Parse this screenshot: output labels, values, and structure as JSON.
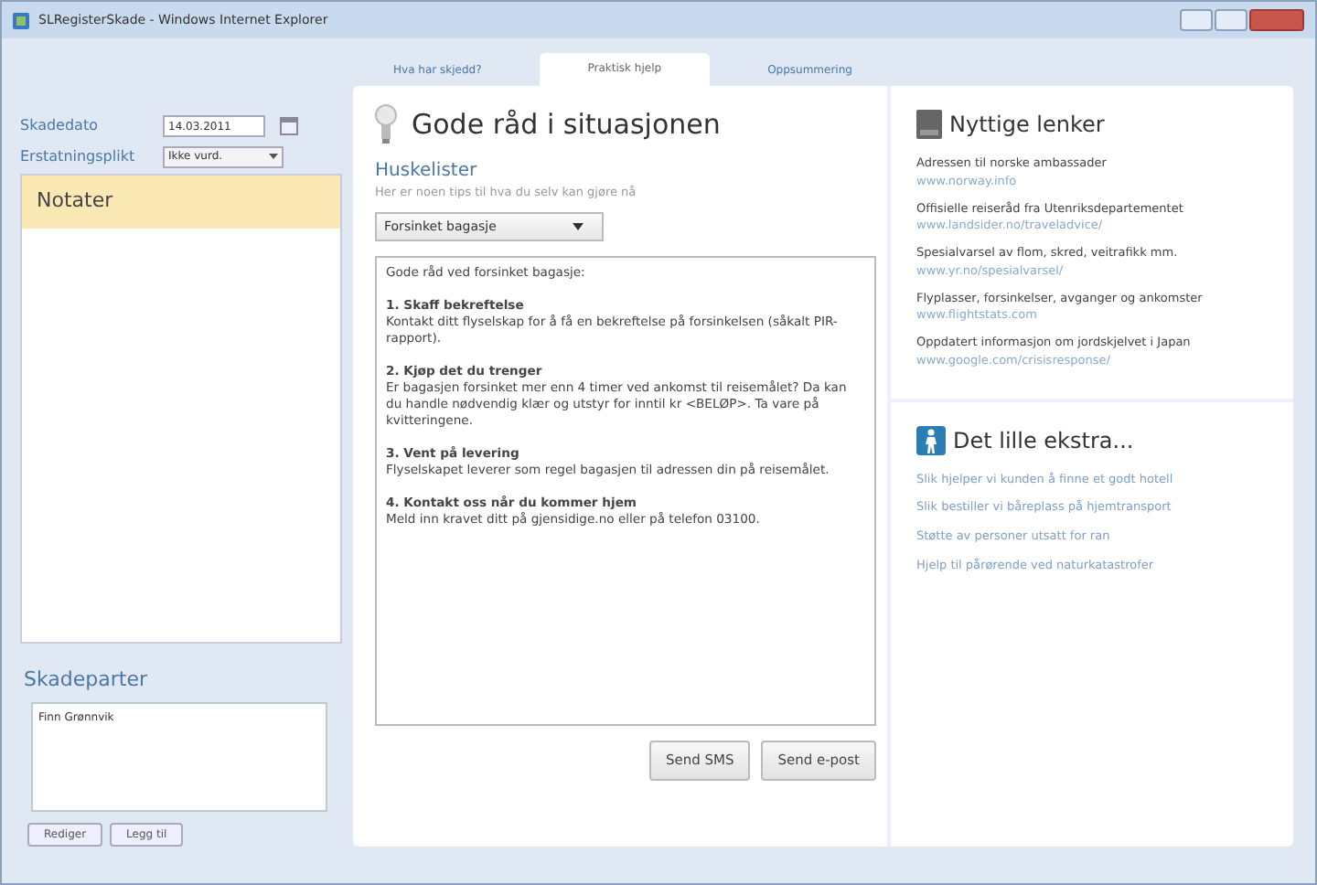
{
  "window": {
    "title": "SLRegisterSkade - Windows Internet Explorer"
  },
  "claim": {
    "date_label": "Skadedato",
    "date_value": "14.03.2011",
    "liability_label": "Erstatningsplikt",
    "liability_value": "Ikke vurd."
  },
  "notes": {
    "title": "Notater"
  },
  "parties": {
    "title": "Skadeparter",
    "items": [
      "Finn Grønnvik"
    ],
    "buttons": [
      "Rediger",
      "Legg til"
    ]
  },
  "tabs": [
    {
      "label": "Hva har skjedd?",
      "selected": false
    },
    {
      "label": "Praktisk hjelp",
      "selected": true
    },
    {
      "label": "Oppsummering",
      "selected": false
    }
  ],
  "advice": {
    "title": "Gode råd i situasjonen",
    "subtitle": "Huskelister",
    "hint": "Her er noen tips til hva du selv kan gjøre nå",
    "dropdown": "Forsinket bagasje",
    "intro": "Gode råd ved forsinket bagasje:",
    "items": [
      {
        "heading": "1. Skaff bekreftelse",
        "body": "Kontakt ditt flyselskap for å få en bekreftelse på forsinkelsen (såkalt PIR-rapport)."
      },
      {
        "heading": "2. Kjøp det du trenger",
        "body": "Er bagasjen forsinket mer enn 4 timer ved ankomst til reisemålet? Da kan du handle nødvendig klær og utstyr for  inntil kr <BELØP>. Ta vare på kvitteringene."
      },
      {
        "heading": "3. Vent på levering",
        "body": "Flyselskapet leverer som regel bagasjen til adressen din på reisemålet."
      },
      {
        "heading": "4. Kontakt oss når du kommer hjem",
        "body": "Meld inn kravet ditt på gjensidige.no eller på telefon 03100."
      }
    ],
    "buttons": [
      "Send SMS",
      "Send e-post"
    ]
  },
  "links": {
    "title": "Nyttige lenker",
    "items": [
      {
        "text": "Adressen til norske ambassader",
        "url": "www.norway.info"
      },
      {
        "text": "Offisielle reiseråd fra Utenriksdepartementet",
        "url": "www.landsider.no/traveladvice/"
      },
      {
        "text": "Spesialvarsel av flom, skred, veitrafikk mm.",
        "url": "www.yr.no/spesialvarsel/"
      },
      {
        "text": "Flyplasser, forsinkelser, avganger og ankomster",
        "url": "www.flightstats.com"
      },
      {
        "text": "Oppdatert informasjon om jordskjelvet i Japan",
        "url": "www.google.com/crisisresponse/"
      }
    ]
  },
  "extra": {
    "title": "Det lille ekstra...",
    "links": [
      "Slik hjelper vi kunden å finne et godt hotell",
      "Slik bestiller vi båreplass på hjemtransport",
      "Støtte av personer utsatt for ran",
      "Hjelp til pårørende ved naturkatastrofer"
    ]
  }
}
